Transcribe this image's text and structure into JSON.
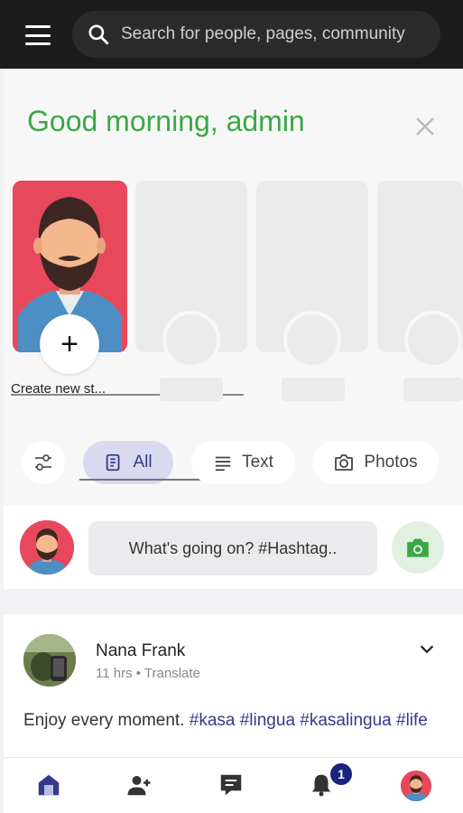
{
  "header": {
    "search": {
      "placeholder": "Search for people, pages, community",
      "value": ""
    },
    "menu_icon": "hamburger-menu-icon",
    "search_icon": "search-icon"
  },
  "greeting": {
    "text": "Good morning, admin",
    "color": "#3aa845"
  },
  "stories": {
    "create_label": "Create new st...",
    "create_icon": "plus-icon",
    "placeholder_count": 3
  },
  "filters": {
    "items": [
      {
        "label": "All",
        "icon": "document-icon",
        "active": true
      },
      {
        "label": "Text",
        "icon": "text-lines-icon",
        "active": false
      },
      {
        "label": "Photos",
        "icon": "camera-icon",
        "active": false
      }
    ],
    "settings_icon": "filter-sliders-icon"
  },
  "composer": {
    "prompt": "What's going on? #Hashtag..",
    "camera_icon": "camera-icon",
    "camera_color": "#3aa845"
  },
  "post": {
    "author": "Nana Frank",
    "time": "11 hrs",
    "separator": "•",
    "translate": "Translate",
    "text_prefix": "Enjoy every moment. ",
    "hashtags": [
      "#kasa",
      "#lingua",
      "#kasalingua",
      "#life"
    ],
    "hashtag_color": "#343a8a"
  },
  "bottom_nav": {
    "items": [
      {
        "name": "home",
        "icon": "home-icon",
        "active": true
      },
      {
        "name": "add-friend",
        "icon": "add-user-icon"
      },
      {
        "name": "messages",
        "icon": "message-icon"
      },
      {
        "name": "notifications",
        "icon": "bell-icon",
        "badge": "1"
      },
      {
        "name": "profile",
        "icon": "avatar-icon"
      }
    ],
    "active_color": "#343a8a"
  },
  "colors": {
    "brand_accent": "#343a8a",
    "story_bg": "#e8485c",
    "topbar": "#1c1c1c"
  }
}
